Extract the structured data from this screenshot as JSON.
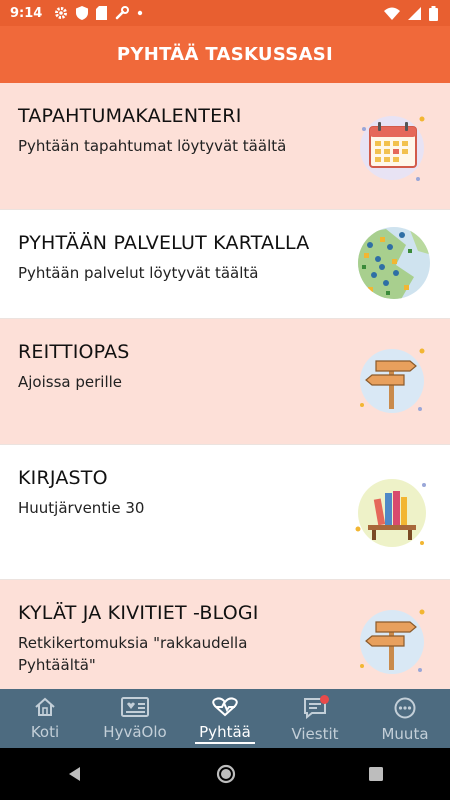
{
  "status_bar": {
    "time": "9:14"
  },
  "header": {
    "title": "PYHTÄÄ TASKUSSASI"
  },
  "items": [
    {
      "title": "TAPAHTUMAKALENTERI",
      "subtitle": "Pyhtään tapahtumat löytyvät täältä",
      "icon": "calendar-icon"
    },
    {
      "title": "PYHTÄÄN PALVELUT KARTALLA",
      "subtitle": "Pyhtään palvelut löytyvät täältä",
      "icon": "map-icon"
    },
    {
      "title": "REITTIOPAS",
      "subtitle": "Ajoissa perille",
      "icon": "signpost-icon"
    },
    {
      "title": "KIRJASTO",
      "subtitle": "Huutjärventie 30",
      "icon": "bookshelf-icon"
    },
    {
      "title": "KYLÄT JA KIVITIET -BLOGI",
      "subtitle": "Retkikertomuksia \"rakkaudella Pyhtäältä\"",
      "icon": "signpost-icon"
    }
  ],
  "tabs": [
    {
      "label": "Koti",
      "icon": "home-icon",
      "active": false
    },
    {
      "label": "HyväOlo",
      "icon": "id-card-icon",
      "active": false
    },
    {
      "label": "Pyhtää",
      "icon": "heart-pulse-icon",
      "active": true
    },
    {
      "label": "Viestit",
      "icon": "message-icon",
      "active": false
    },
    {
      "label": "Muuta",
      "icon": "more-icon",
      "active": false
    }
  ],
  "colors": {
    "header": "#f0693a",
    "statusbar": "#e85f30",
    "row_pink": "#fde0d8",
    "tabbar": "#4d6b80"
  }
}
